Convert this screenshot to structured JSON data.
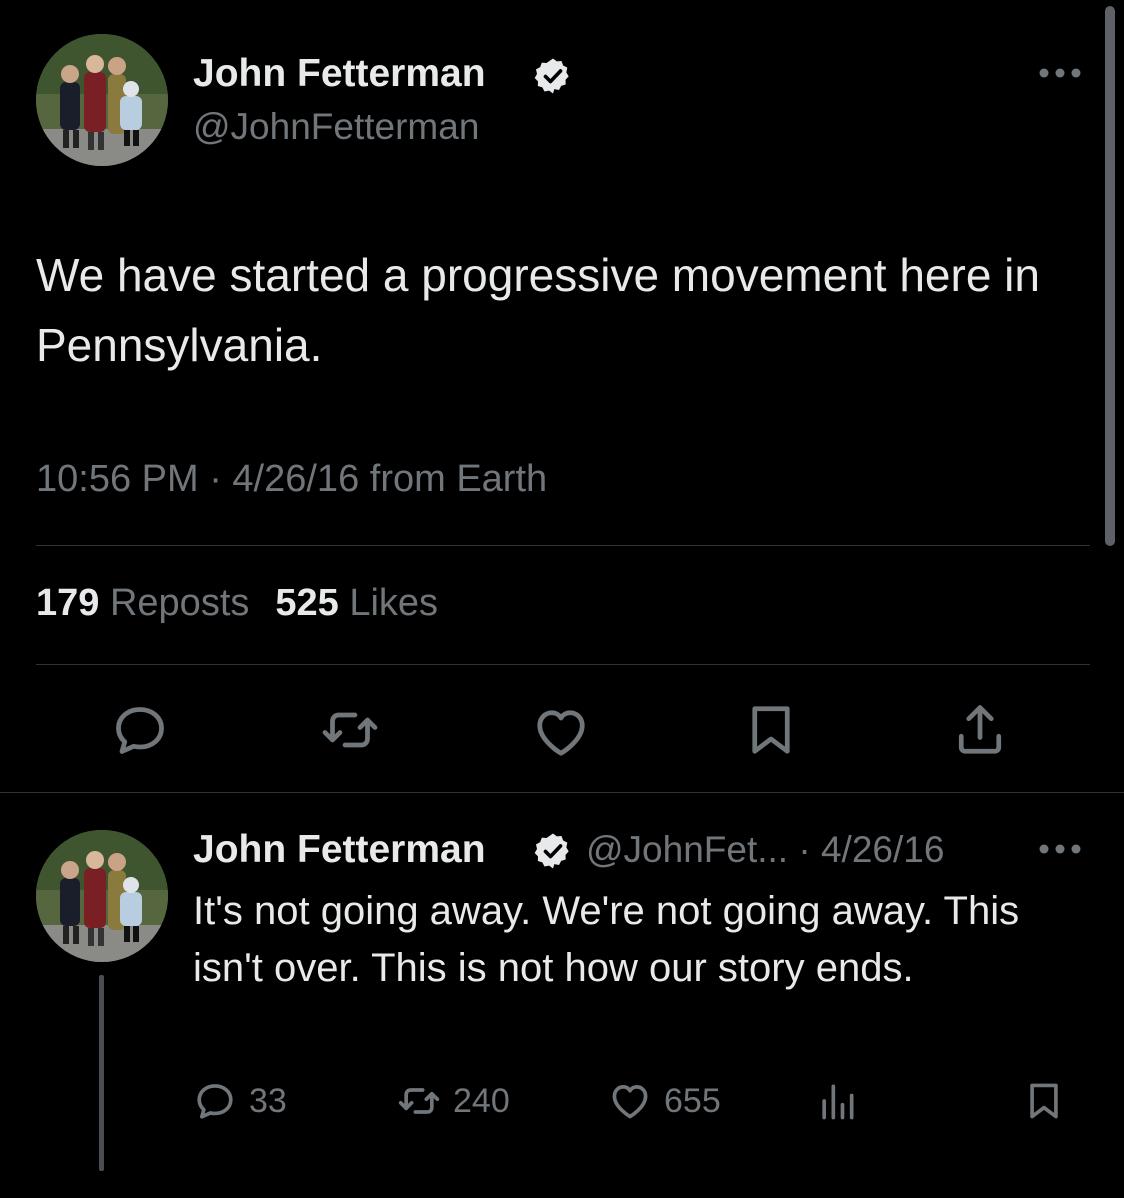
{
  "tweet": {
    "author_name": "John Fetterman",
    "handle": "@JohnFetterman",
    "text": "We have started a progressive movement here in Pennsylvania.",
    "meta": "10:56 PM · 4/26/16 from Earth",
    "stats": {
      "reposts_count": "179",
      "reposts_label": "Reposts",
      "likes_count": "525",
      "likes_label": "Likes"
    }
  },
  "reply": {
    "author_name": "John Fetterman",
    "handle_date": "@JohnFet... · 4/26/16",
    "text": "It's not going away. We're not going away. This isn't over. This is not how our story ends.",
    "counts": {
      "replies": "33",
      "reposts": "240",
      "likes": "655"
    }
  },
  "colors": {
    "background": "#000000",
    "primary_text": "#e7e9ea",
    "secondary_text": "#71767b",
    "divider": "#2f3336"
  },
  "icons": [
    "verified-badge-icon",
    "more-icon",
    "reply-icon",
    "repost-icon",
    "like-icon",
    "bookmark-icon",
    "share-icon",
    "views-icon"
  ]
}
